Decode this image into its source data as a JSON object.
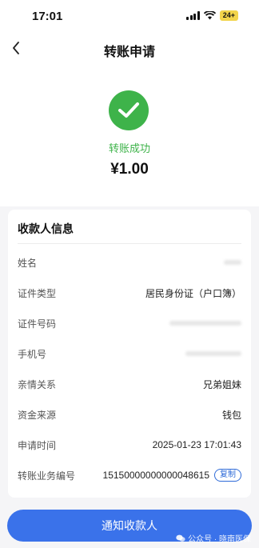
{
  "status_bar": {
    "time": "17:01",
    "battery": "24+"
  },
  "nav": {
    "title": "转账申请"
  },
  "result": {
    "status": "转账成功",
    "amount": "¥1.00"
  },
  "payee": {
    "section_title": "收款人信息",
    "rows": [
      {
        "label": "姓名",
        "value": ""
      },
      {
        "label": "证件类型",
        "value": "居民身份证（户口簿）"
      },
      {
        "label": "证件号码",
        "value": ""
      },
      {
        "label": "手机号",
        "value": ""
      },
      {
        "label": "亲情关系",
        "value": "兄弟姐妹"
      },
      {
        "label": "资金来源",
        "value": "钱包"
      },
      {
        "label": "申请时间",
        "value": "2025-01-23 17:01:43"
      },
      {
        "label": "转账业务编号",
        "value": "15150000000000048615"
      }
    ],
    "copy_label": "复制"
  },
  "actions": {
    "notify_label": "通知收款人"
  },
  "watermark": {
    "text": "公众号 · 晓南医保"
  },
  "colors": {
    "success": "#3eb34a",
    "primary": "#3a72ea"
  }
}
